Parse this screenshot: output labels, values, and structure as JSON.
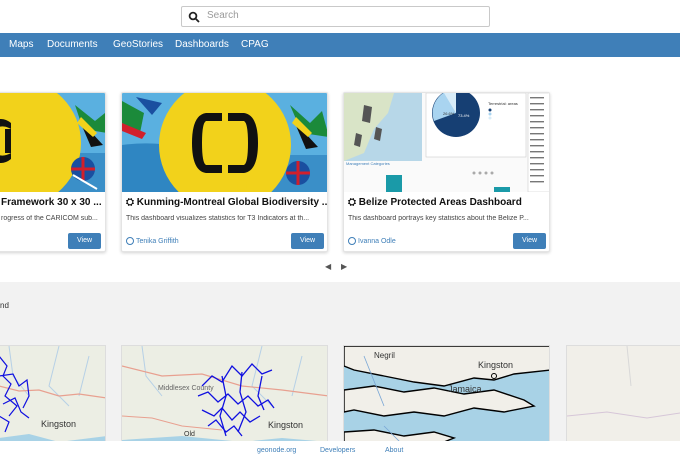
{
  "search": {
    "placeholder": "Search"
  },
  "nav": {
    "items": [
      "Maps",
      "Documents",
      "GeoStories",
      "Dashboards",
      "CPAG"
    ]
  },
  "cards": [
    {
      "title": "Framework 30 x 30 ...",
      "desc": "rogress of the CARICOM sub...",
      "owner": "",
      "view_label": "View"
    },
    {
      "title": "Kunming-Montreal Global Biodiversity ...",
      "desc": "This dashboard visualizes statistics for T3 Indicators at th...",
      "owner": "Tenika Griffith",
      "view_label": "View"
    },
    {
      "title": "Belize Protected Areas Dashboard",
      "desc": "This dashboard portrays key statistics about the Belize P...",
      "owner": "Ivanna Odle",
      "view_label": "View"
    }
  ],
  "carousel": {
    "prev": "◀",
    "next": "▶"
  },
  "section": {
    "label": "nd"
  },
  "maps": {
    "labels": [
      "Kingston",
      "Kingston",
      "Middlesex County",
      "Old",
      "Kingston",
      "Negril",
      "Jamaica"
    ]
  },
  "footer": {
    "links": [
      "geonode.org",
      "Developers",
      "About"
    ]
  },
  "colors": {
    "nav": "#3f7fb8",
    "accent": "#3f7fb8",
    "caricom_yellow": "#f2d21b",
    "sea": "#4aa4d6"
  }
}
